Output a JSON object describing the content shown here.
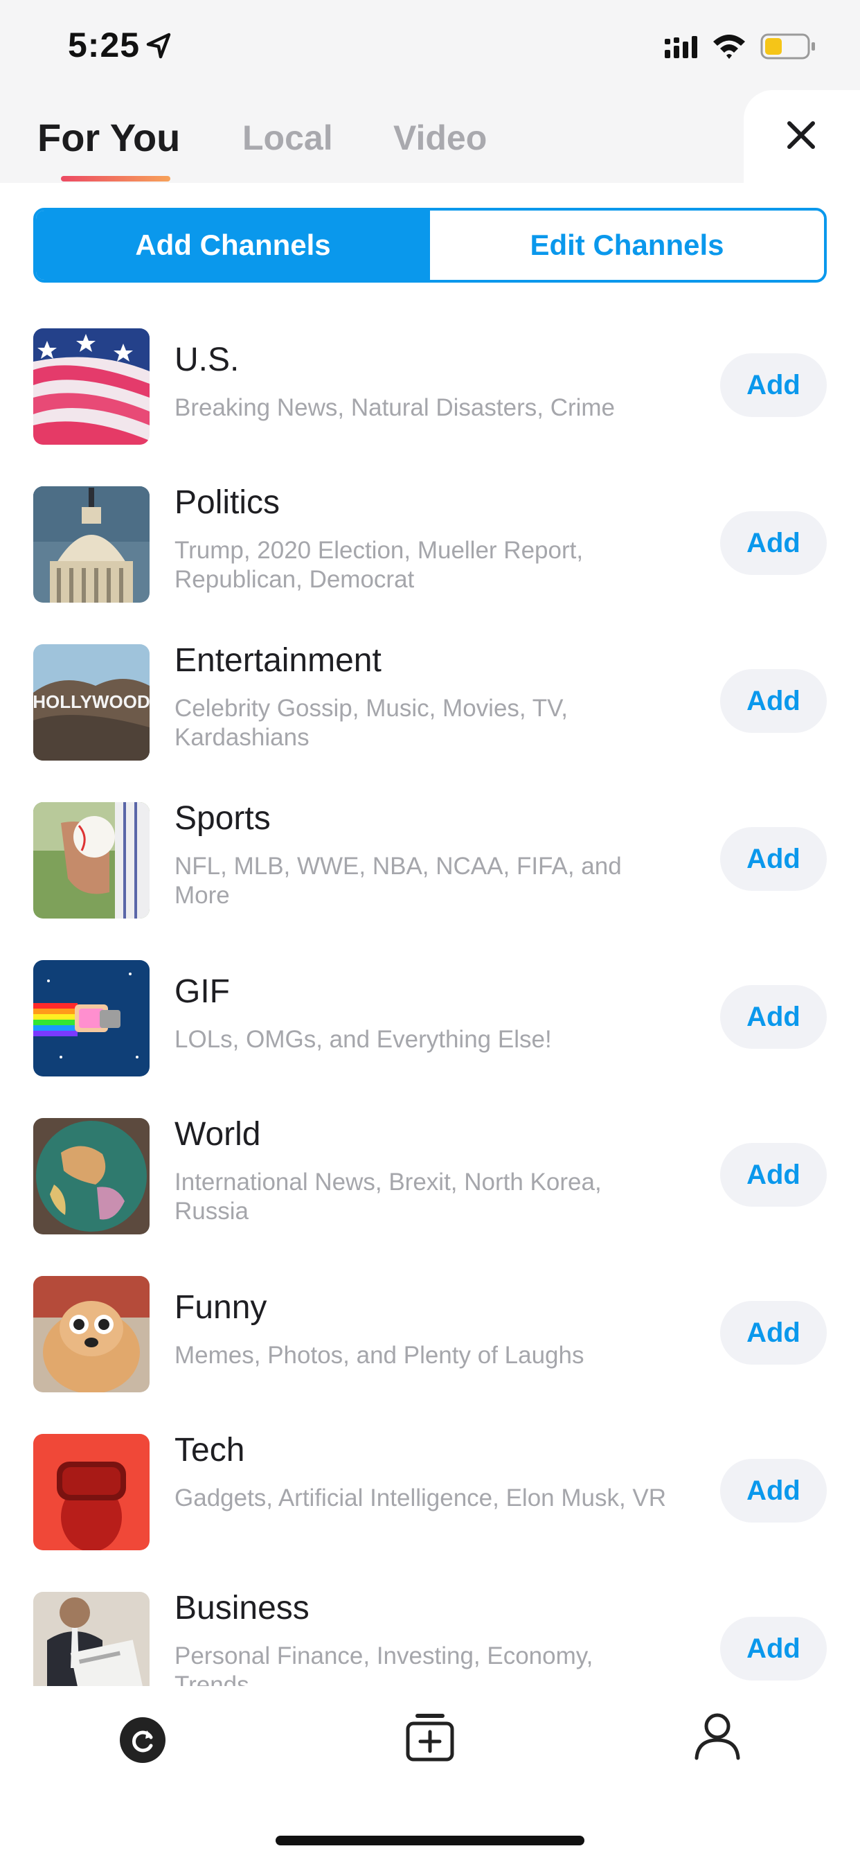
{
  "status_bar": {
    "time": "5:25",
    "icons": [
      "location-arrow-icon",
      "cellular-signal-icon",
      "wifi-icon",
      "battery-low-icon"
    ],
    "battery_color": "#f5c518"
  },
  "header": {
    "tabs": [
      {
        "label": "For You",
        "active": true
      },
      {
        "label": "Local",
        "active": false
      },
      {
        "label": "Video",
        "active": false
      }
    ],
    "close_icon": "close-icon"
  },
  "segment": {
    "add_label": "Add Channels",
    "edit_label": "Edit Channels",
    "selected": "Add Channels"
  },
  "channels": [
    {
      "name": "U.S.",
      "desc": "Breaking News, Natural Disasters, Crime",
      "button": "Add",
      "image": "american-flag"
    },
    {
      "name": "Politics",
      "desc": "Trump, 2020 Election, Mueller Report, Republican, Democrat",
      "button": "Add",
      "image": "capitol-dome"
    },
    {
      "name": "Entertainment",
      "desc": "Celebrity Gossip, Music, Movies, TV, Kardashians",
      "button": "Add",
      "image": "hollywood-sign",
      "image_text": "HOLLYWOOD"
    },
    {
      "name": "Sports",
      "desc": "NFL, MLB, WWE, NBA, NCAA, FIFA, and More",
      "button": "Add",
      "image": "baseball-in-hand"
    },
    {
      "name": "GIF",
      "desc": "LOLs, OMGs, and Everything Else!",
      "button": "Add",
      "image": "nyan-cat"
    },
    {
      "name": "World",
      "desc": "International News, Brexit, North Korea, Russia",
      "button": "Add",
      "image": "globe"
    },
    {
      "name": "Funny",
      "desc": "Memes, Photos, and Plenty of Laughs",
      "button": "Add",
      "image": "dog-with-sunglasses"
    },
    {
      "name": "Tech",
      "desc": "Gadgets, Artificial Intelligence, Elon Musk, VR",
      "button": "Add",
      "image": "vr-headset"
    },
    {
      "name": "Business",
      "desc": "Personal Finance, Investing, Economy, Trends",
      "button": "Add",
      "image": "man-reading-newspaper"
    }
  ],
  "bottom_nav": {
    "items": [
      "refresh-icon",
      "add-channel-icon",
      "profile-icon"
    ]
  },
  "colors": {
    "accent": "#0a98ec",
    "tab_gradient_start": "#ec4a63",
    "tab_gradient_end": "#f7a25a",
    "header_bg": "#f5f5f6"
  }
}
